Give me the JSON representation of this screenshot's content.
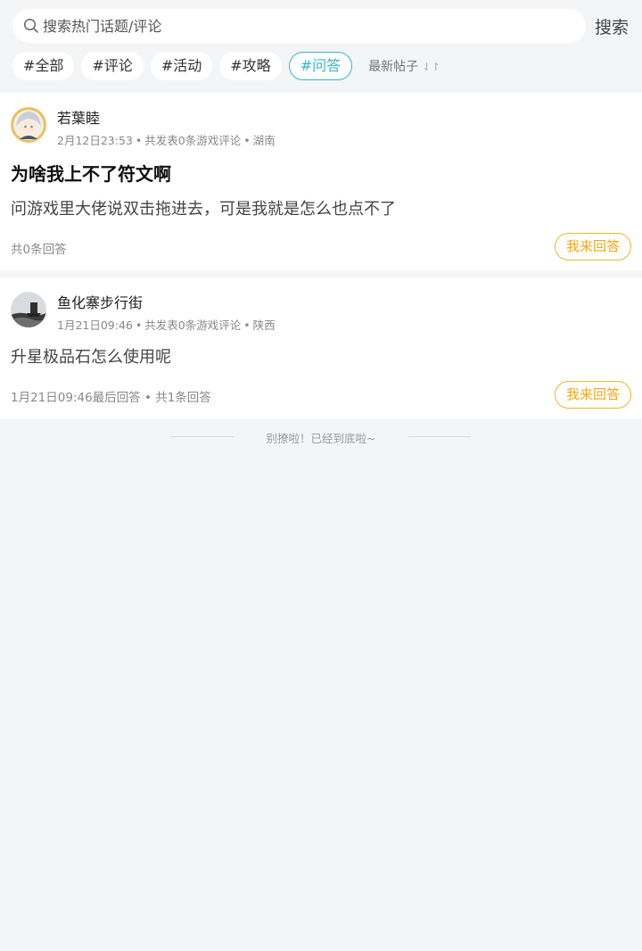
{
  "search": {
    "placeholder": "搜索热门话题/评论",
    "button_label": "搜索"
  },
  "tags": [
    {
      "label": "#全部",
      "active": false
    },
    {
      "label": "#评论",
      "active": false
    },
    {
      "label": "#活动",
      "active": false
    },
    {
      "label": "#攻略",
      "active": false
    },
    {
      "label": "#问答",
      "active": true
    }
  ],
  "sort": {
    "label": "最新帖子",
    "icon": "sort-arrows-icon"
  },
  "posts": [
    {
      "author": "若葉睦",
      "time": "2月12日23:53",
      "stats": "共发表0条游戏评论",
      "location": "湖南",
      "title": "为啥我上不了符文啊",
      "body": "问游戏里大佬说双击拖进去，可是我就是怎么也点不了",
      "footer": "共0条回答",
      "answer_label": "我来回答"
    },
    {
      "author": "鱼化寨步行街",
      "time": "1月21日09:46",
      "stats": "共发表0条游戏评论",
      "location": "陕西",
      "body": "升星极品石怎么使用呢",
      "footer": "1月21日09:46最后回答 • 共1条回答",
      "answer_label": "我来回答"
    }
  ],
  "end_text": "别撩啦！已经到底啦~",
  "colors": {
    "accent_teal": "#35b6c6",
    "answer_orange": "#f0a81a",
    "background": "#f4f5f7"
  }
}
